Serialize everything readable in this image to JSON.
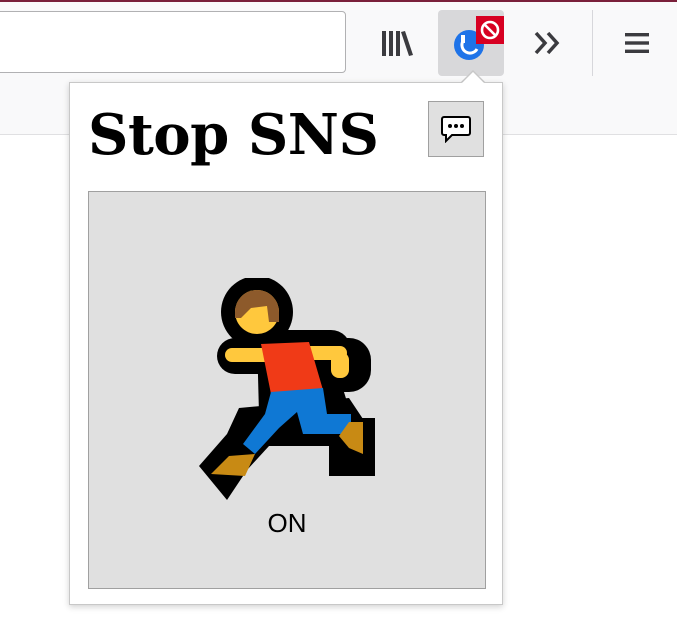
{
  "popup": {
    "title": "Stop SNS",
    "toggle_state": "ON"
  },
  "toolbar": {
    "icons": [
      "library-icon",
      "stop-sns-extension-icon",
      "overflow-chevron-icon",
      "hamburger-menu-icon"
    ]
  },
  "colors": {
    "badge": "#d70022",
    "extension_blue": "#1e73e8",
    "toggle_bg": "#e0e0e0",
    "frame_accent": "#7a1f3a"
  }
}
